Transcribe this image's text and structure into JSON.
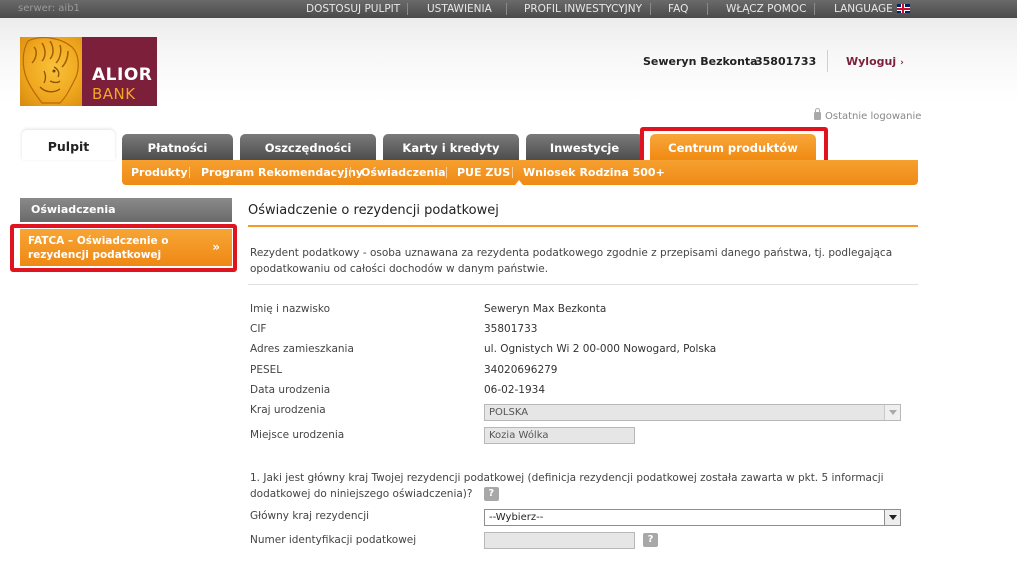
{
  "topbar": {
    "server": "serwer: aib1",
    "links": [
      "DOSTOSUJ PULPIT",
      "USTAWIENIA",
      "PROFIL INWESTYCYJNY",
      "FAQ",
      "WŁĄCZ POMOC",
      "LANGUAGE"
    ],
    "flag_icon": "uk-flag-icon"
  },
  "brand": {
    "name_line1": "ALIOR",
    "name_line2": "BANK",
    "colors": {
      "primary": "#7b1f3a",
      "accent": "#f5a623",
      "highlight": "#e0141e"
    }
  },
  "user": {
    "name": "Seweryn Bezkonta",
    "id": "35801733",
    "logout_label": "Wyloguj",
    "last_login_label": "Ostatnie logowanie"
  },
  "tabs": [
    {
      "label": "Pulpit",
      "active": true
    },
    {
      "label": "Płatności"
    },
    {
      "label": "Oszczędności"
    },
    {
      "label": "Karty i kredyty"
    },
    {
      "label": "Inwestycje"
    },
    {
      "label": "Centrum produktów",
      "highlighted": true
    }
  ],
  "subnav": [
    "Produkty",
    "Program Rekomendacyjny",
    "Oświadczenia",
    "PUE ZUS",
    "Wniosek Rodzina 500+"
  ],
  "sidebar": {
    "heading": "Oświadczenia",
    "item": "FATCA – Oświadczenie o rezydencji podatkowej",
    "item_arrow": "»"
  },
  "content": {
    "title": "Oświadczenie o rezydencji podatkowej",
    "intro": "Rezydent podatkowy - osoba uznawana za rezydenta podatkowego zgodnie z przepisami danego państwa, tj. podlegająca opodatkowaniu od całości dochodów w danym państwie.",
    "fields": [
      {
        "label": "Imię i nazwisko",
        "value": "Seweryn Max Bezkonta"
      },
      {
        "label": "CIF",
        "value": "35801733"
      },
      {
        "label": "Adres zamieszkania",
        "value": "ul. Ognistych Wi 2 00-000 Nowogard, Polska"
      },
      {
        "label": "PESEL",
        "value": "34020696279"
      },
      {
        "label": "Data urodzenia",
        "value": "06-02-1934"
      },
      {
        "label": "Kraj urodzenia",
        "value": "POLSKA"
      },
      {
        "label": "Miejsce urodzenia",
        "value": "Kozia Wólka"
      }
    ],
    "question": "1. Jaki jest główny kraj Twojej rezydencji podatkowej (definicja rezydencji podatkowej została zawarta w pkt. 5 informacji dodatkowej do niniejszego oświadczenia)?",
    "help_label": "?",
    "residence_label": "Główny kraj rezydencji",
    "residence_value": "--Wybierz--",
    "tax_id_label": "Numer identyfikacji podatkowej",
    "tax_id_value": ""
  }
}
